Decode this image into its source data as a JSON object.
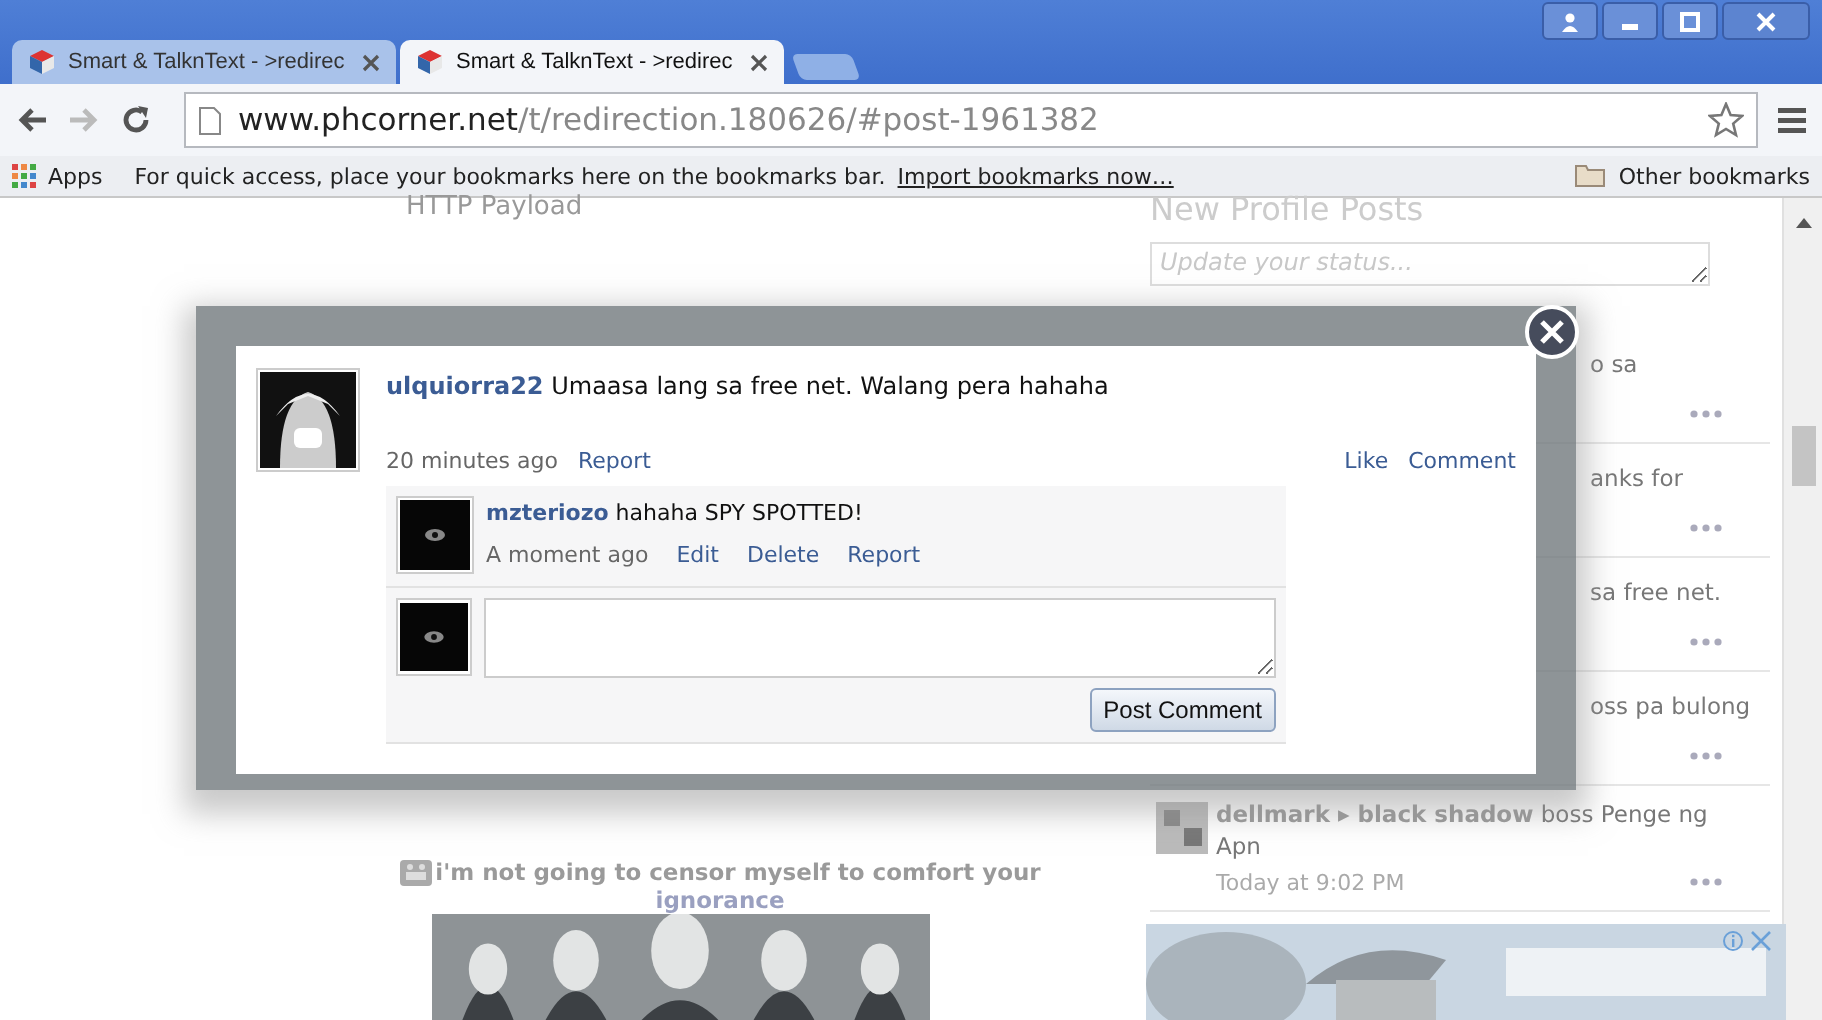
{
  "browser": {
    "tabs": [
      {
        "title": "Smart & TalknText - >redirec",
        "selected": false
      },
      {
        "title": "Smart & TalknText - >redirec",
        "selected": true
      }
    ],
    "address": {
      "domain": "www.phcorner.net",
      "path": "/t/redirection.180626/#post-1961382"
    },
    "bookmarks_bar": {
      "apps": "Apps",
      "hint": "For quick access, place your bookmarks here on the bookmarks bar.",
      "import_link": "Import bookmarks now…",
      "other": "Other bookmarks"
    }
  },
  "page": {
    "post_heading": "HTTP Payload",
    "sidebar": {
      "heading": "New Profile Posts",
      "status_placeholder": "Update your status...",
      "items": [
        {
          "kind": "partial",
          "text": "o sa"
        },
        {
          "kind": "partial",
          "text": "anks for"
        },
        {
          "kind": "partial",
          "text": "sa free net."
        },
        {
          "kind": "partial",
          "text": "oss pa bulong"
        },
        {
          "kind": "full",
          "names": "dellmark ▸ black shadow",
          "text": "boss Penge ng Apn",
          "time": "Today at 9:02 PM"
        }
      ]
    },
    "signature": {
      "text": "i'm not going to censor myself to comfort your",
      "link": "ignorance"
    }
  },
  "modal": {
    "post": {
      "author": "ulquiorra22",
      "message": "Umaasa lang sa free net. Walang pera hahaha",
      "time": "20 minutes ago",
      "actions": [
        "Report"
      ],
      "right_actions": [
        "Like",
        "Comment"
      ]
    },
    "comments": [
      {
        "author": "mzteriozo",
        "message": "hahaha SPY SPOTTED!",
        "time": "A moment ago",
        "actions": [
          "Edit",
          "Delete",
          "Report"
        ]
      }
    ],
    "reply": {
      "button": "Post Comment"
    }
  }
}
